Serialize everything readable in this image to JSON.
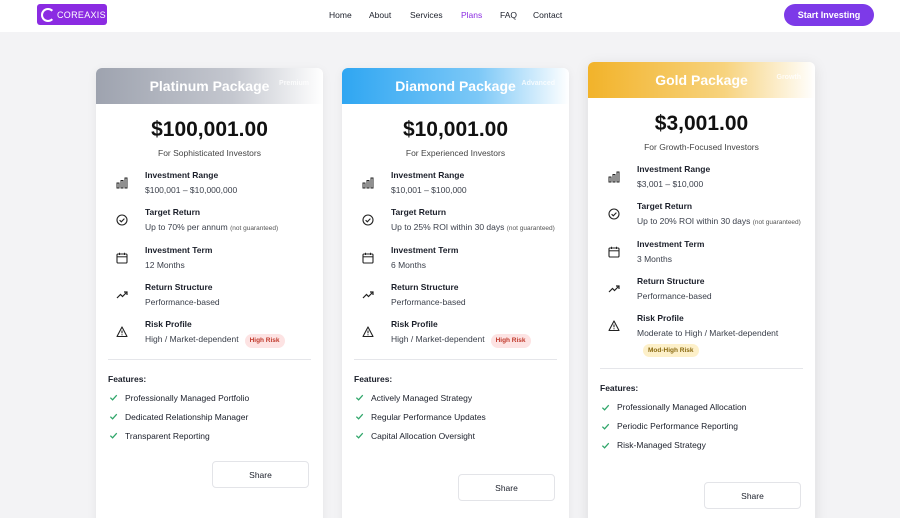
{
  "brand": {
    "name": "COREAXIS",
    "color": "#8b2be2"
  },
  "nav": {
    "items": [
      {
        "label": "Home"
      },
      {
        "label": "About"
      },
      {
        "label": "Services"
      },
      {
        "label": "Plans",
        "active": true
      },
      {
        "label": "FAQ"
      },
      {
        "label": "Contact"
      }
    ],
    "cta": "Start Investing"
  },
  "cards": [
    {
      "name": "Platinum Package",
      "badge": "Premium",
      "price": "$100,001.00",
      "tagline": "For Sophisticated Investors",
      "header_gradient": [
        "#9aa0ac",
        "#ffffff"
      ],
      "rows": [
        {
          "icon": "bar-chart-icon",
          "title": "Investment Range",
          "value": "$100,001 – $10,000,000"
        },
        {
          "icon": "target-check-icon",
          "title": "Target Return",
          "value": "Up to 70% per annum",
          "note": "(not guaranteed)"
        },
        {
          "icon": "calendar-icon",
          "title": "Investment Term",
          "value": "12 Months"
        },
        {
          "icon": "trending-up-icon",
          "title": "Return Structure",
          "value": "Performance-based"
        },
        {
          "icon": "warning-icon",
          "title": "Risk Profile",
          "value": "High / Market-dependent",
          "risk": "High Risk"
        }
      ],
      "features_title": "Features:",
      "features": [
        "Professionally Managed Portfolio",
        "Dedicated Relationship Manager",
        "Transparent Reporting"
      ],
      "share": "Share"
    },
    {
      "name": "Diamond Package",
      "badge": "Advanced",
      "price": "$10,001.00",
      "tagline": "For Experienced Investors",
      "header_gradient": [
        "#3aa8f0",
        "#ffffff"
      ],
      "rows": [
        {
          "icon": "bar-chart-icon",
          "title": "Investment Range",
          "value": "$10,001 – $100,000"
        },
        {
          "icon": "target-check-icon",
          "title": "Target Return",
          "value": "Up to 25% ROI within 30 days",
          "note": "(not guaranteed)"
        },
        {
          "icon": "calendar-icon",
          "title": "Investment Term",
          "value": "6 Months"
        },
        {
          "icon": "trending-up-icon",
          "title": "Return Structure",
          "value": "Performance-based"
        },
        {
          "icon": "warning-icon",
          "title": "Risk Profile",
          "value": "High / Market-dependent",
          "risk": "High Risk"
        }
      ],
      "features_title": "Features:",
      "features": [
        "Actively Managed Strategy",
        "Regular Performance Updates",
        "Capital Allocation Oversight"
      ],
      "share": "Share"
    },
    {
      "name": "Gold Package",
      "badge": "Growth",
      "price": "$3,001.00",
      "tagline": "For Growth-Focused Investors",
      "header_gradient": [
        "#f2b62b",
        "#ffffff"
      ],
      "rows": [
        {
          "icon": "bar-chart-icon",
          "title": "Investment Range",
          "value": "$3,001 – $10,000"
        },
        {
          "icon": "target-check-icon",
          "title": "Target Return",
          "value": "Up to 20% ROI within 30 days",
          "note": "(not guaranteed)"
        },
        {
          "icon": "calendar-icon",
          "title": "Investment Term",
          "value": "3 Months"
        },
        {
          "icon": "trending-up-icon",
          "title": "Return Structure",
          "value": "Performance-based"
        },
        {
          "icon": "warning-icon",
          "title": "Risk Profile",
          "value": "Moderate to High / Market-dependent",
          "risk": "Mod-High Risk"
        }
      ],
      "features_title": "Features:",
      "features": [
        "Professionally Managed Allocation",
        "Periodic Performance Reporting",
        "Risk-Managed Strategy"
      ],
      "share": "Share"
    }
  ],
  "colors": {
    "risk_high_bg": "#fde3e3",
    "risk_high_fg": "#c0392b",
    "risk_mod_bg": "#fdf0c9",
    "risk_mod_fg": "#8a6a10",
    "check": "#2fa66a"
  }
}
